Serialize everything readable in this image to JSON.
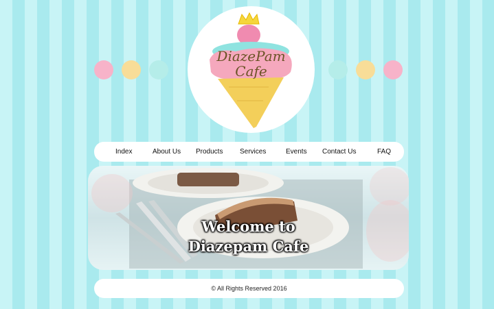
{
  "logo": {
    "line1": "DiazePam",
    "line2": "Cafe",
    "icon": "ice-cream-crown-icon"
  },
  "dots": {
    "left": [
      "#f7b3c9",
      "#f8dd98",
      "#b5ede9"
    ],
    "right": [
      "#b5ede9",
      "#f8dd98",
      "#f7b3c9"
    ]
  },
  "nav": {
    "items": [
      "Index",
      "About Us",
      "Products",
      "Services",
      "Events",
      "Contact Us",
      "FAQ"
    ]
  },
  "banner": {
    "line1": "Welcome to",
    "line2": "Diazepam Cafe"
  },
  "footer": {
    "text": "© All Rights Reserved 2016"
  },
  "colors": {
    "stripe_light": "#c8f4f6",
    "stripe_dark": "#a9eaee",
    "panel": "#ffffff"
  }
}
